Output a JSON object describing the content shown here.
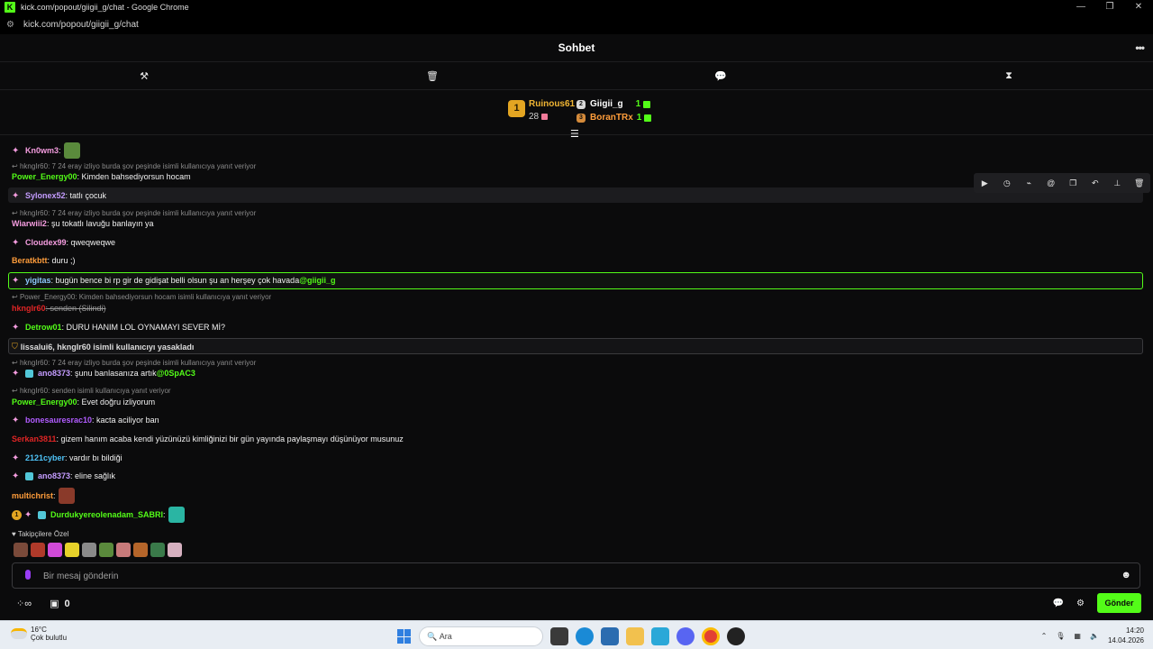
{
  "window": {
    "title": "kick.com/popout/giigii_g/chat - Google Chrome",
    "url": "kick.com/popout/giigii_g/chat",
    "logo": "K"
  },
  "header": {
    "title": "Sohbet",
    "more_icon": "•••"
  },
  "toolbar": {
    "icons": [
      "hammer-icon",
      "trash-icon",
      "chat-bubble-icon",
      "hourglass-icon"
    ]
  },
  "leaderboard": {
    "first": {
      "rank": "1",
      "name": "Ruinous61",
      "count": "28"
    },
    "second": {
      "name": "Giigii_g",
      "count": "1"
    },
    "third": {
      "name": "BoranTRx",
      "count": "1"
    }
  },
  "messages": [
    {
      "user": "Kn0wm3",
      "text": "",
      "user_color": "#f59de0"
    },
    {
      "reply": "hkngIr60: 7 24 eray izliyo burda şov peşinde isimli kullanıcıya yanıt veriyor"
    },
    {
      "user": "Power_Energy00",
      "text": ": Kimden bahsediyorsun hocam",
      "user_color": "#53fc18"
    },
    {
      "user": "Sylonex52",
      "text": ": tatlı çocuk",
      "user_color": "#c49cff"
    },
    {
      "reply": "hkngIr60: 7 24 eray izliyo burda şov peşinde isimli kullanıcıya yanıt veriyor"
    },
    {
      "user": "Wiarwiii2",
      "text": ": şu tokatlı lavuğu banlayın ya",
      "user_color": "#f59de0"
    },
    {
      "user": "Cloudex99",
      "text": ": qweqweqwe",
      "user_color": "#f59de0"
    },
    {
      "user": "Beratkbtt",
      "text": ": duru ;)",
      "user_color": "#ff9d3b"
    },
    {
      "user": "yigitas",
      "text": ": bugün bence bi rp gir de gidişat belli olsun şu an herşey çok havada ",
      "mention": "@giigii_g",
      "user_color": "#8ec9ff"
    },
    {
      "reply": "Power_Energy00: Kimden bahsediyorsun hocam isimli kullanıcıya yanıt veriyor"
    },
    {
      "user": "hkngIr60",
      "text": ": senden (Silindi)",
      "user_color": "#e02525"
    },
    {
      "user": "Detrow01",
      "text": ": DURU HANIM LOL OYNAMAYI SEVER Mİ?",
      "user_color": "#53fc18"
    },
    {
      "system": "lissalui6, hkngIr60 isimli kullanıcıyı yasakladı"
    },
    {
      "reply": "hkngIr60: 7 24 eray izliyo burda şov peşinde isimli kullanıcıya yanıt veriyor"
    },
    {
      "user": "ano8373",
      "text": ": şunu banlasanıza artık ",
      "mention": "@0SpAC3",
      "user_color": "#c49cff"
    },
    {
      "reply": "hkngIr60: senden isimli kullanıcıya yanıt veriyor"
    },
    {
      "user": "Power_Energy00",
      "text": ": Evet doğru izliyorum",
      "user_color": "#53fc18"
    },
    {
      "user": "bonesauresrac10",
      "text": ": kacta aciliyor ban",
      "user_color": "#b15cff"
    },
    {
      "user": "Serkan3811",
      "text": ": gizem hanım acaba kendi yüzünüzü kimliğinizi bir gün yayında paylaşmayı düşünüyor musunuz",
      "user_color": "#e02525"
    },
    {
      "user": "2121cyber",
      "text": ": vardır bı bildiği",
      "user_color": "#4fc3f7"
    },
    {
      "user": "ano8373",
      "text": ": eline sağlık",
      "user_color": "#c49cff"
    },
    {
      "user": "multichrist",
      "text": ":",
      "user_color": "#ff9d3b"
    },
    {
      "user": "Durdukyereolenadam_SABRI",
      "text": ":",
      "user_color": "#53fc18"
    }
  ],
  "followers_label": "Takipçilere Özel",
  "input": {
    "placeholder": "Bir mesaj gönderin"
  },
  "bottom": {
    "gift_count": "0",
    "send_label": "Gönder"
  },
  "taskbar": {
    "temp": "16°C",
    "weather": "Çok bulutlu",
    "search_placeholder": "Ara",
    "time": "14:20",
    "date": "14.04.2026"
  },
  "colors": {
    "kick_green": "#53fc18",
    "gold": "#e3a522",
    "background": "#0b0b0c"
  }
}
